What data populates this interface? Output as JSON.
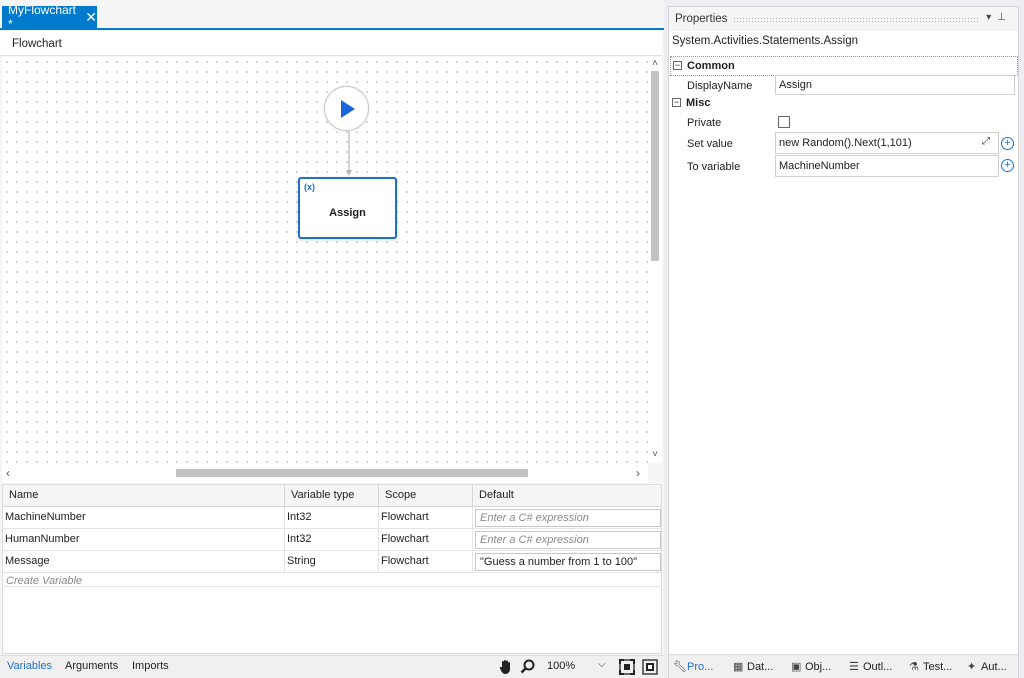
{
  "document": {
    "tab_title": "MyFlowchart *",
    "breadcrumb": "Flowchart"
  },
  "designer": {
    "assign_node_label": "Assign",
    "assign_node_icon_text": "(x)"
  },
  "variables": {
    "columns": [
      "Name",
      "Variable type",
      "Scope",
      "Default"
    ],
    "rows": [
      {
        "name": "MachineNumber",
        "type": "Int32",
        "scope": "Flowchart",
        "default": "Enter a C# expression",
        "is_placeholder": true
      },
      {
        "name": "HumanNumber",
        "type": "Int32",
        "scope": "Flowchart",
        "default": "Enter a C# expression",
        "is_placeholder": true
      },
      {
        "name": "Message",
        "type": "String",
        "scope": "Flowchart",
        "default": "\"Guess a number from 1 to 100\"",
        "is_placeholder": false
      }
    ],
    "create_variable": "Create Variable"
  },
  "bottom_bar": {
    "tabs": [
      "Variables",
      "Arguments",
      "Imports"
    ],
    "active_tab": "Variables",
    "zoom": "100%"
  },
  "properties": {
    "title": "Properties",
    "type_name": "System.Activities.Statements.Assign",
    "categories": {
      "common": "Common",
      "misc": "Misc"
    },
    "fields": {
      "display_name_label": "DisplayName",
      "display_name_value": "Assign",
      "private_label": "Private",
      "set_value_label": "Set value",
      "set_value_value": "new Random().Next(1,101)",
      "to_variable_label": "To variable",
      "to_variable_value": "MachineNumber"
    },
    "bottom_tabs": [
      "Pro...",
      "Dat...",
      "Obj...",
      "Outl...",
      "Test...",
      "Aut..."
    ]
  },
  "colors": {
    "accent": "#007acc",
    "node_border": "#1f6fd1",
    "start_triangle": "#1a66d8"
  }
}
